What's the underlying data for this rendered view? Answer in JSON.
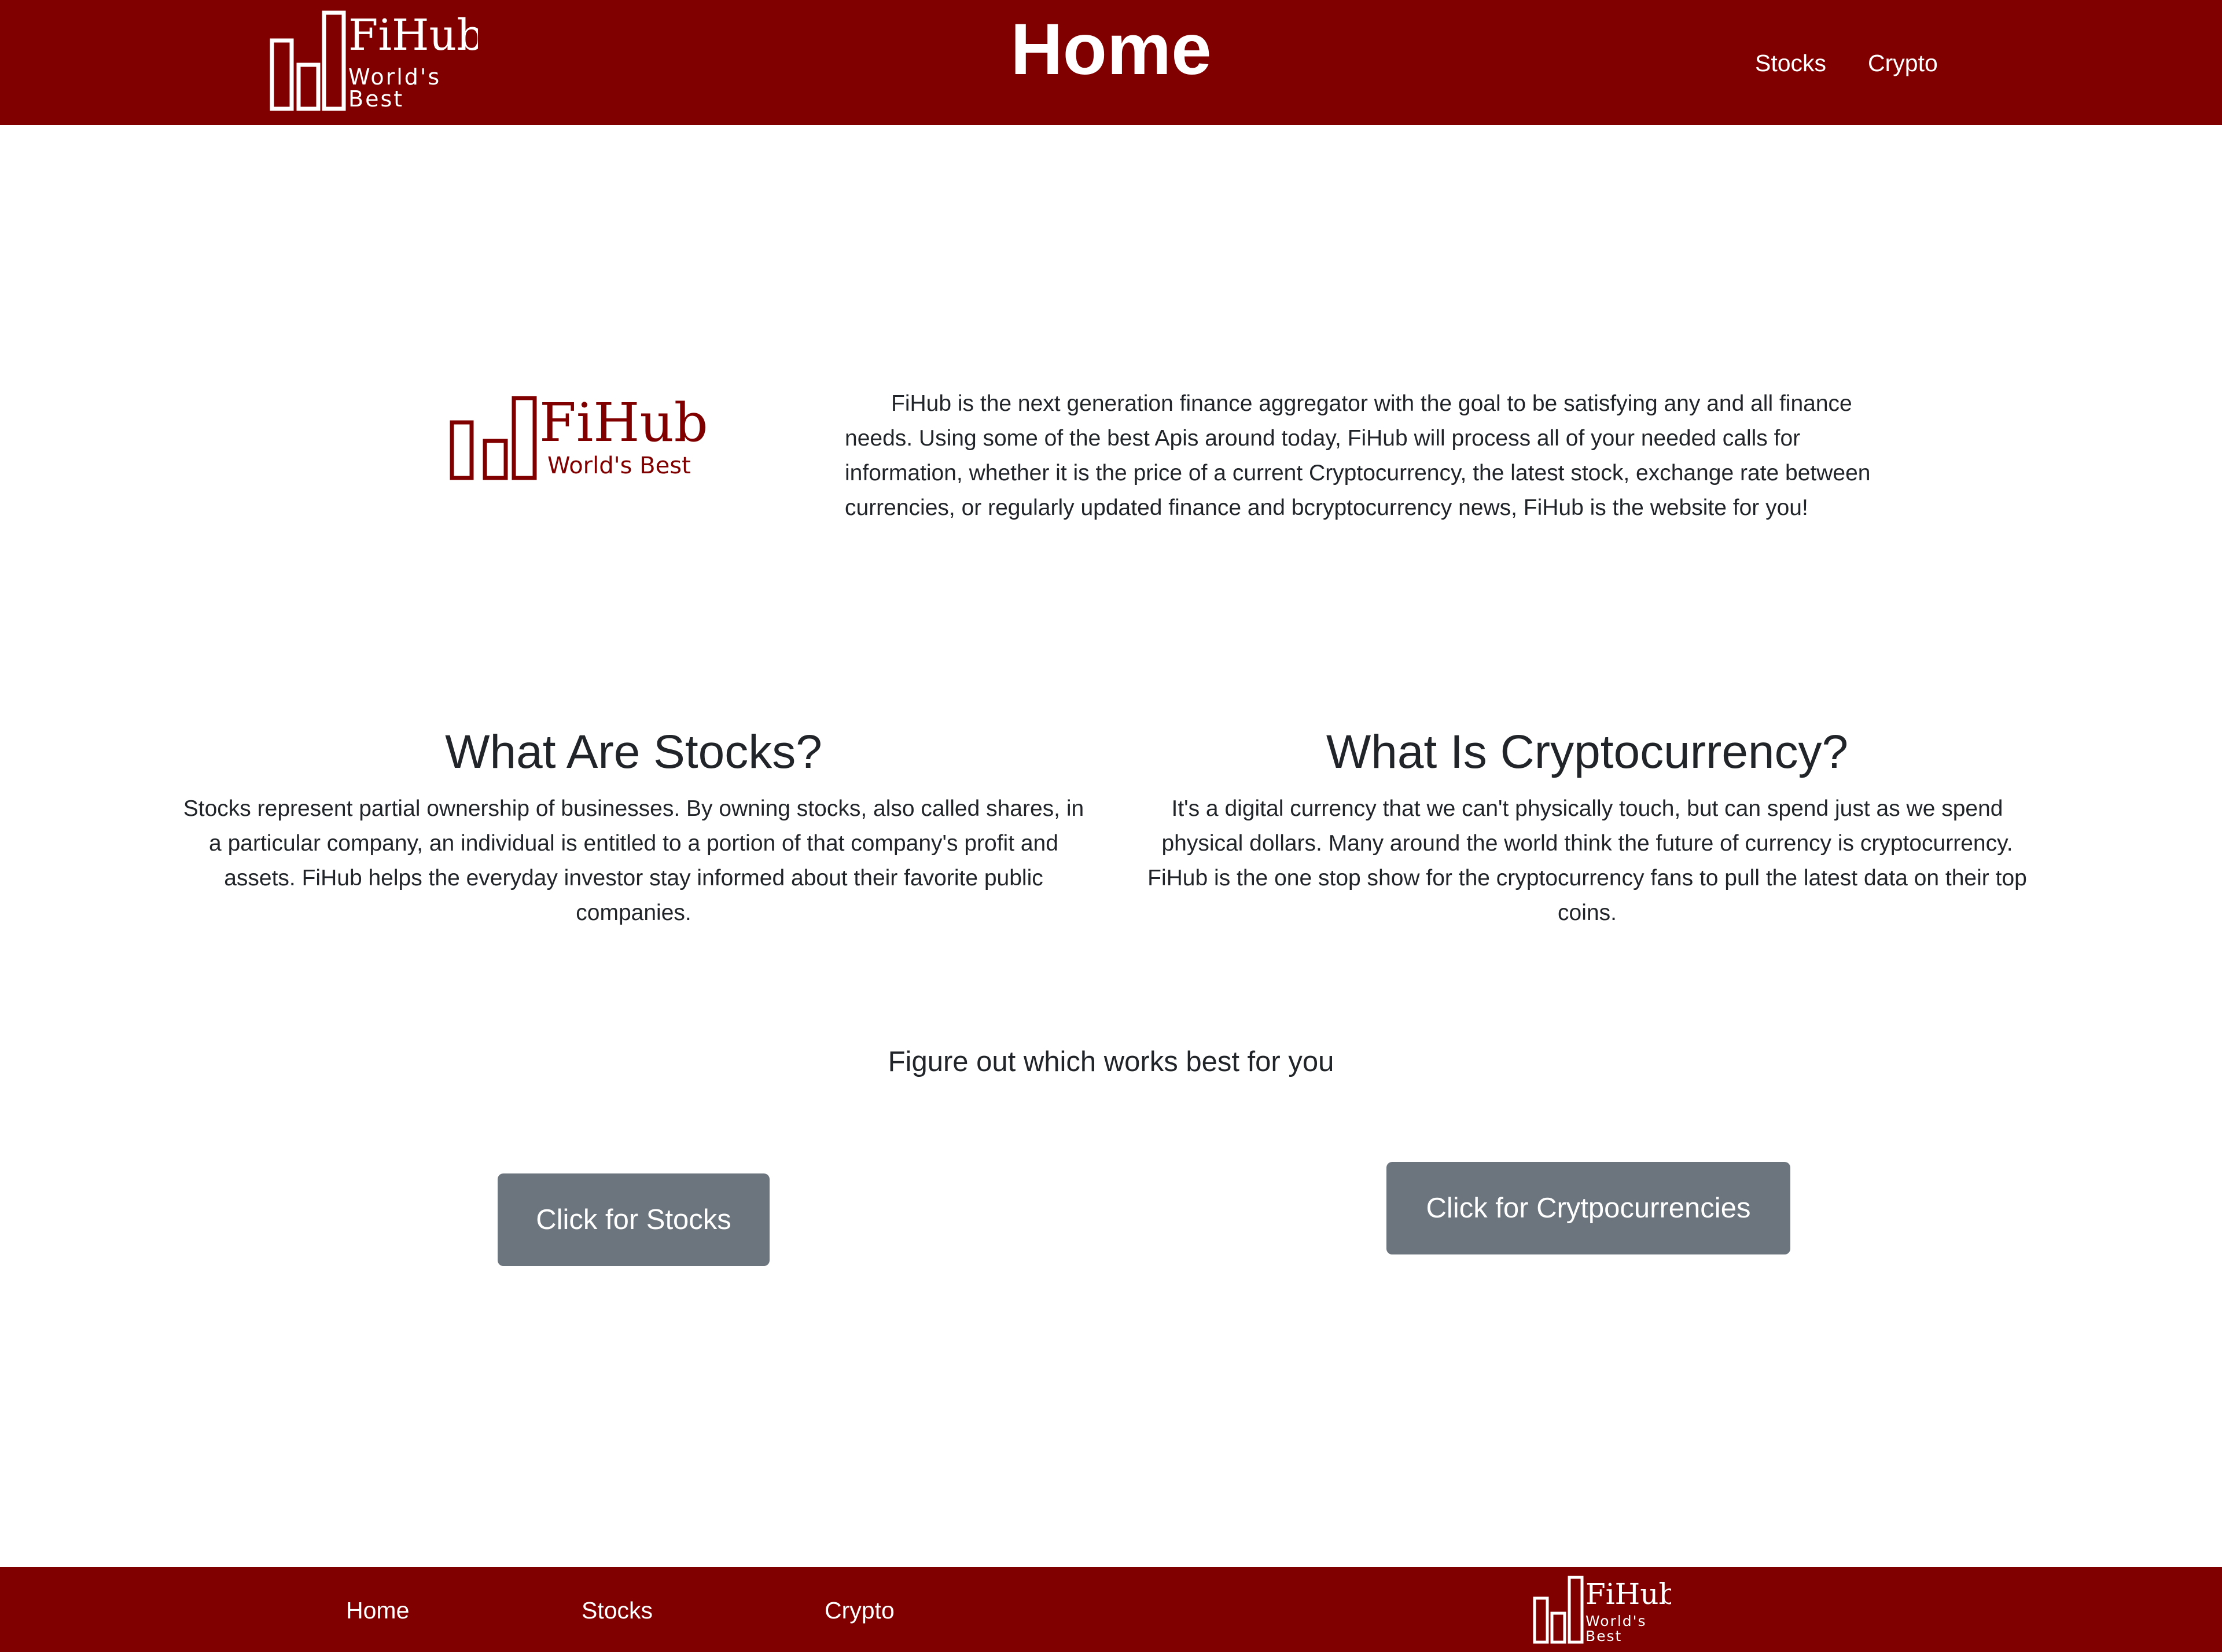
{
  "header": {
    "title": "Home",
    "nav": [
      {
        "label": "Stocks"
      },
      {
        "label": "Crypto"
      }
    ]
  },
  "logo": {
    "word": "FiHub",
    "tag_line1": "World's",
    "tag_line2": "Best",
    "tag_full": "World's Best"
  },
  "about": {
    "text": "FiHub is the next generation finance aggregator with the goal to be satisfying any and all finance needs. Using some of the best Apis around today, FiHub will process all of your needed calls for information, whether it is the price of a current Cryptocurrency, the latest stock, exchange rate between currencies, or regularly updated finance and bcryptocurrency news, FiHub is the website for you!"
  },
  "stocks_section": {
    "heading": "What Are Stocks?",
    "body": "Stocks represent partial ownership of businesses. By owning stocks, also called shares, in a particular company, an individual is entitled to a portion of that company's profit and assets. FiHub helps the everyday investor stay informed about their favorite public companies."
  },
  "crypto_section": {
    "heading": "What Is Cryptocurrency?",
    "body": "It's a digital currency that we can't physically touch, but can spend just as we spend physical dollars. Many around the world think the future of currency is cryptocurrency. FiHub is the one stop show for the cryptocurrency fans to pull the latest data on their top coins."
  },
  "prompt": "Figure out which works best for you",
  "buttons": {
    "stocks": "Click for Stocks",
    "crypto": "Click for Crytpocurrencies"
  },
  "footer": {
    "links": [
      {
        "label": "Home"
      },
      {
        "label": "Stocks"
      },
      {
        "label": "Crypto"
      }
    ]
  },
  "colors": {
    "brand": "#800000",
    "button": "#6c757d",
    "text": "#212529",
    "background": "#ffffff"
  }
}
